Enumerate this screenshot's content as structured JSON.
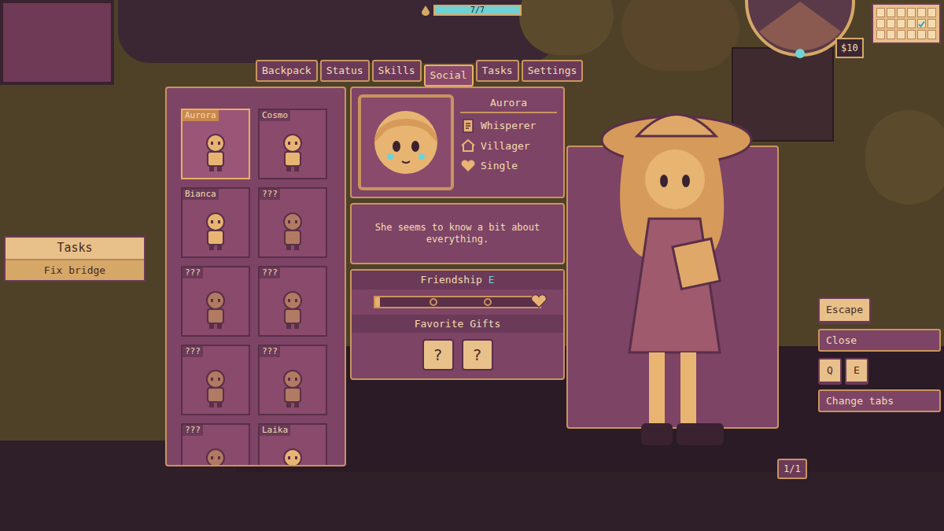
{
  "hud": {
    "water": "7/7",
    "water_level": 1,
    "money": "$10",
    "calendar": [
      {
        "checked": false
      },
      {
        "checked": false
      },
      {
        "checked": false
      },
      {
        "checked": false
      },
      {
        "checked": false
      },
      {
        "checked": false
      },
      {
        "checked": false
      },
      {
        "checked": false
      },
      {
        "checked": false
      },
      {
        "checked": false
      },
      {
        "checked": true
      },
      {
        "checked": false
      },
      {
        "checked": false
      },
      {
        "checked": false
      },
      {
        "checked": false
      },
      {
        "checked": false
      },
      {
        "checked": false
      },
      {
        "checked": false
      }
    ]
  },
  "tabs": [
    {
      "label": "Backpack",
      "selected": false
    },
    {
      "label": "Status",
      "selected": false
    },
    {
      "label": "Skills",
      "selected": false
    },
    {
      "label": "Social",
      "selected": true
    },
    {
      "label": "Tasks",
      "selected": false
    },
    {
      "label": "Settings",
      "selected": false
    }
  ],
  "tasks_widget": {
    "title": "Tasks",
    "items": [
      "Fix bridge"
    ]
  },
  "characters": [
    {
      "name": "Aurora",
      "selected": true,
      "known": true
    },
    {
      "name": "Cosmo",
      "selected": false,
      "known": true
    },
    {
      "name": "Bianca",
      "selected": false,
      "known": true
    },
    {
      "name": "???",
      "selected": false,
      "known": false
    },
    {
      "name": "???",
      "selected": false,
      "known": false
    },
    {
      "name": "???",
      "selected": false,
      "known": false
    },
    {
      "name": "???",
      "selected": false,
      "known": false
    },
    {
      "name": "???",
      "selected": false,
      "known": false
    },
    {
      "name": "???",
      "selected": false,
      "known": false
    },
    {
      "name": "Laika",
      "selected": false,
      "known": true
    }
  ],
  "detail": {
    "name": "Aurora",
    "attributes": [
      {
        "label": "Whisperer",
        "kind": "job"
      },
      {
        "label": "Villager",
        "kind": "home"
      },
      {
        "label": "Single",
        "kind": "heart"
      }
    ],
    "description": "She seems to know a bit about everything.",
    "friendship": {
      "label": "Friendship",
      "rank": "E",
      "level": 0.02
    },
    "favorite_gifts": {
      "title": "Favorite Gifts",
      "slots": [
        "?",
        "?"
      ]
    }
  },
  "page": "1/1",
  "controls": [
    {
      "keys": [
        "Escape"
      ],
      "action": "Close"
    },
    {
      "keys": [
        "Q",
        "E"
      ],
      "action": "Change tabs"
    }
  ]
}
